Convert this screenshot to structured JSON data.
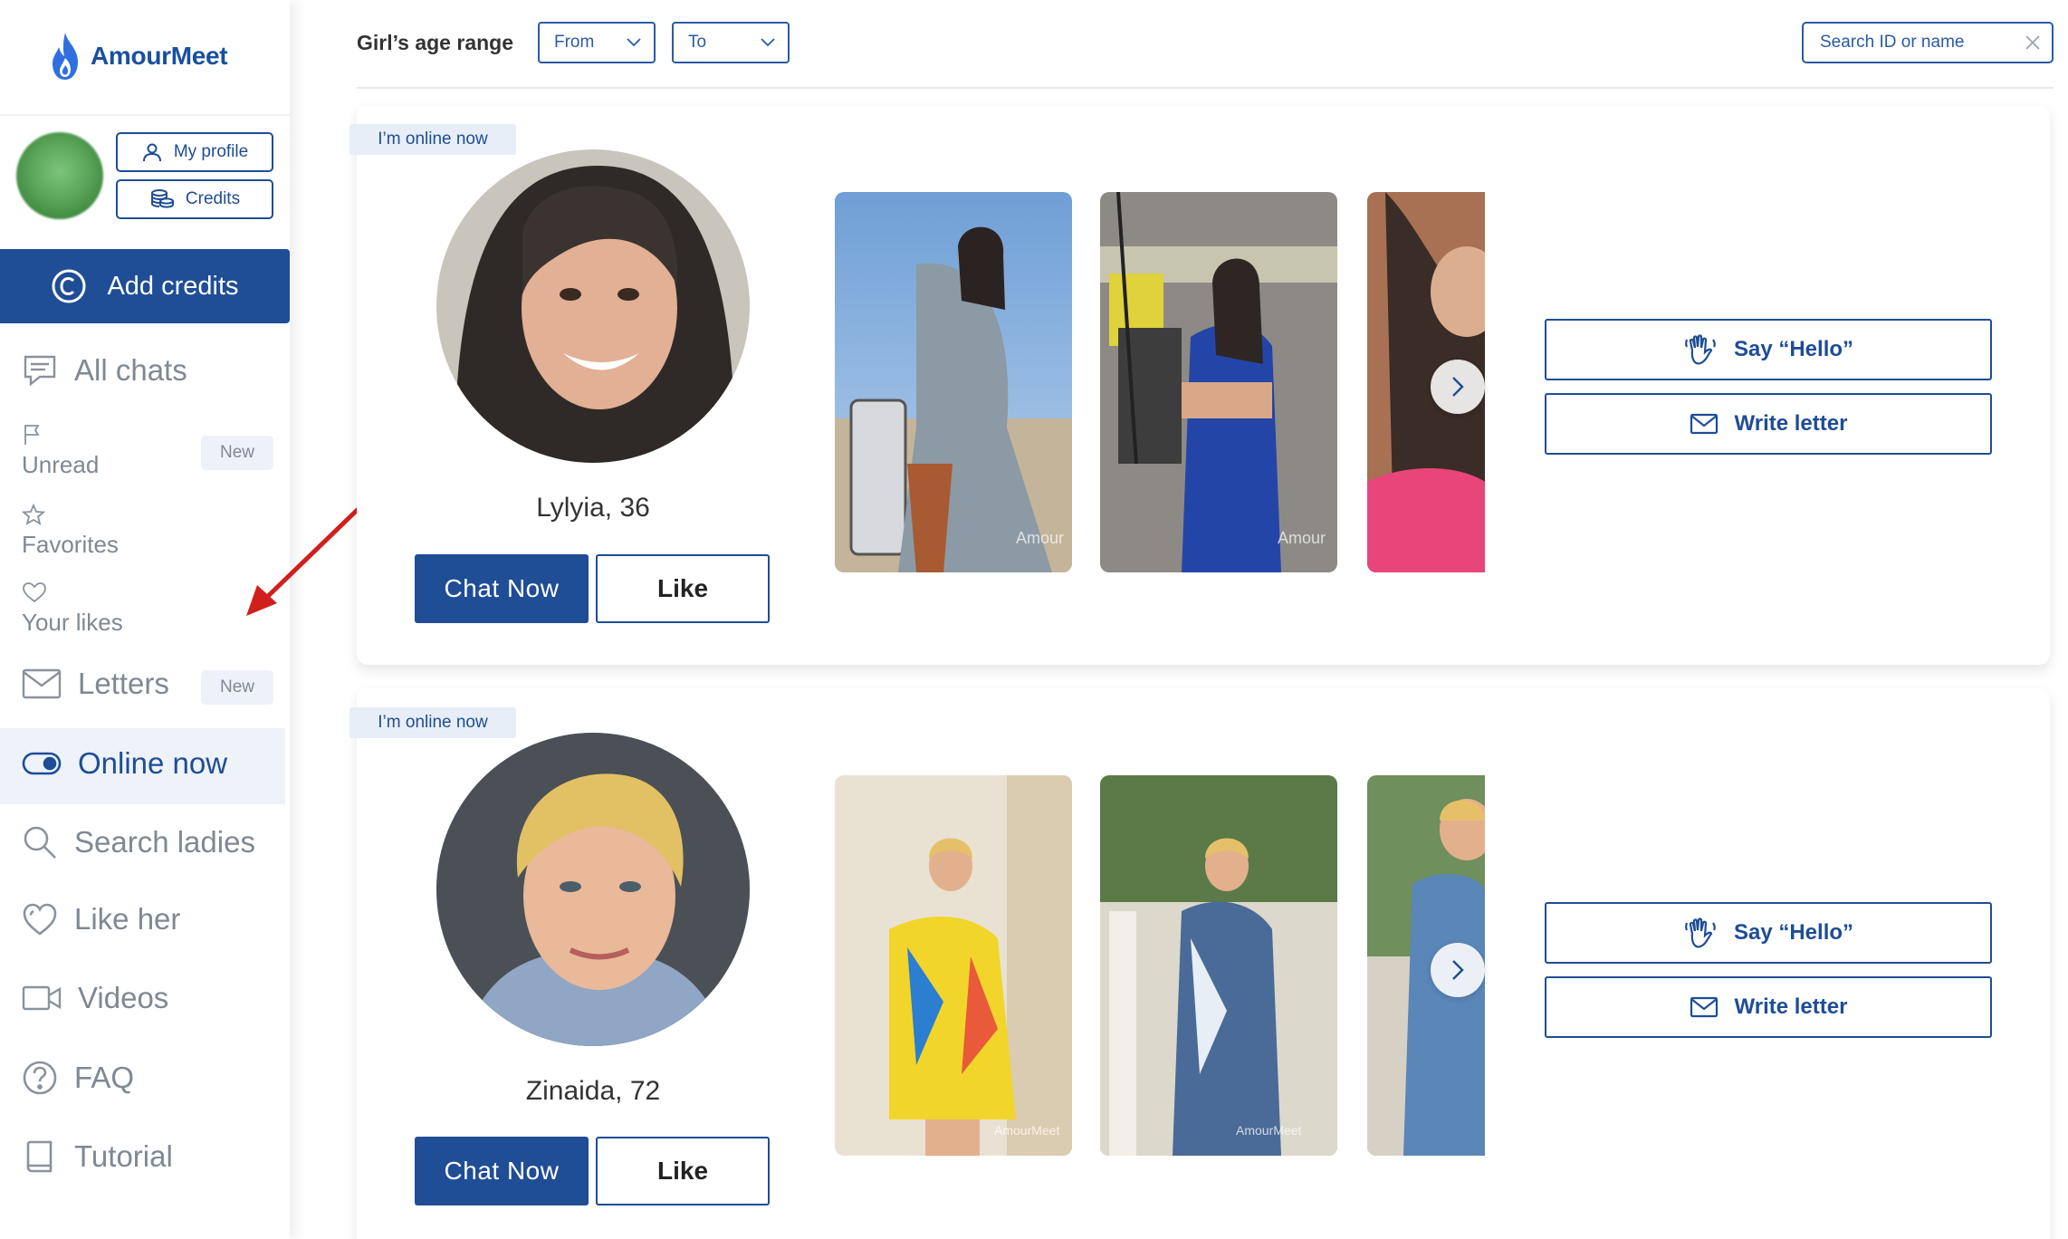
{
  "brand": {
    "name": "AmourMeet",
    "accent": "#1f4d96",
    "flame_color": "#2f6fe0"
  },
  "profile": {
    "my_profile_label": "My profile",
    "credits_label": "Credits",
    "add_credits_label": "Add credits"
  },
  "nav": {
    "all_chats": "All chats",
    "unread": "Unread",
    "unread_badge": "New",
    "favorites": "Favorites",
    "your_likes": "Your likes",
    "letters": "Letters",
    "letters_badge": "New",
    "online_now": "Online now",
    "search_ladies": "Search ladies",
    "like_her": "Like her",
    "videos": "Videos",
    "faq": "FAQ",
    "tutorial": "Tutorial",
    "active_item": "Online now"
  },
  "filter": {
    "age_label": "Girl’s age range",
    "from_label": "From",
    "to_label": "To",
    "search_placeholder": "Search ID or name"
  },
  "cards": [
    {
      "online_label": "I’m online now",
      "name": "Lylyia, 36",
      "chat_label": "Chat Now",
      "like_label": "Like",
      "say_hello_label": "Say “Hello”",
      "write_letter_label": "Write letter",
      "watermark": "Amour"
    },
    {
      "online_label": "I’m online now",
      "name": "Zinaida, 72",
      "chat_label": "Chat Now",
      "like_label": "Like",
      "say_hello_label": "Say “Hello”",
      "write_letter_label": "Write letter",
      "watermark": "AmourMeet"
    }
  ]
}
